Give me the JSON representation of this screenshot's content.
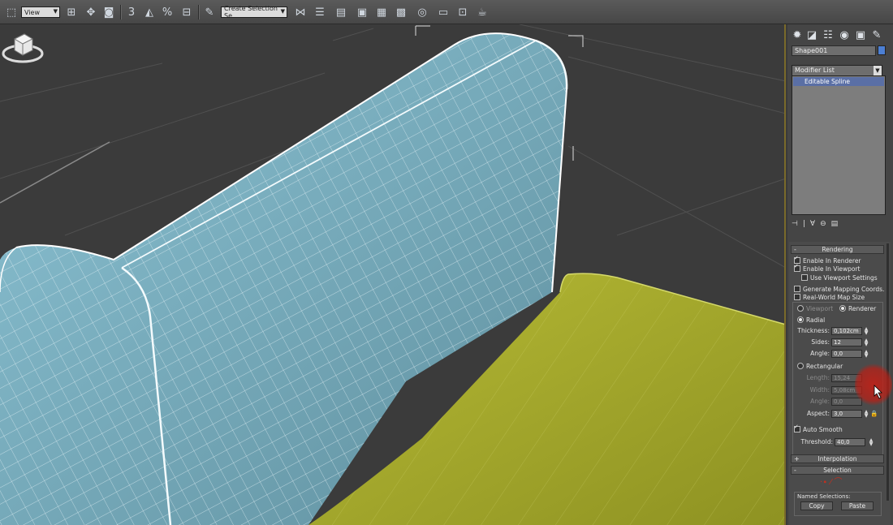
{
  "toolbar": {
    "view_dropdown": "View",
    "selection_set_dropdown": "Create Selection Se",
    "snap_label": "3",
    "percent_label": "%"
  },
  "command_panel": {
    "object_name": "Shape001",
    "object_color": "#4c7fd3",
    "modifier_list": "Modifier List",
    "stack_items": [
      "Editable Spline"
    ]
  },
  "rendering": {
    "title": "Rendering",
    "enable_in_renderer": "Enable In Renderer",
    "enable_in_viewport": "Enable In Viewport",
    "use_viewport_settings": "Use Viewport Settings",
    "generate_mapping_coords": "Generate Mapping Coords.",
    "real_world_map_size": "Real-World Map Size",
    "viewport_label": "Viewport",
    "renderer_label": "Renderer",
    "radial_label": "Radial",
    "thickness_label": "Thickness:",
    "thickness_value": "0,102cm",
    "sides_label": "Sides:",
    "sides_value": "12",
    "angle_label": "Angle:",
    "angle_value": "0,0",
    "rectangular_label": "Rectangular",
    "length_label": "Length:",
    "length_value": "15,24",
    "width_label": "Width:",
    "width_value": "5,08cm",
    "rect_angle_label": "Angle:",
    "rect_angle_value": "0,0",
    "aspect_label": "Aspect:",
    "aspect_value": "3,0",
    "auto_smooth_label": "Auto Smooth",
    "threshold_label": "Threshold:",
    "threshold_value": "40,0"
  },
  "interpolation": {
    "title": "Interpolation"
  },
  "selection": {
    "title": "Selection",
    "named_selections": "Named Selections:",
    "copy_button": "Copy",
    "paste_button": "Paste"
  },
  "colors": {
    "cushion": "#7fb6c8",
    "seat": "#a8ac2c",
    "viewport_border": "#7a6a2a"
  }
}
